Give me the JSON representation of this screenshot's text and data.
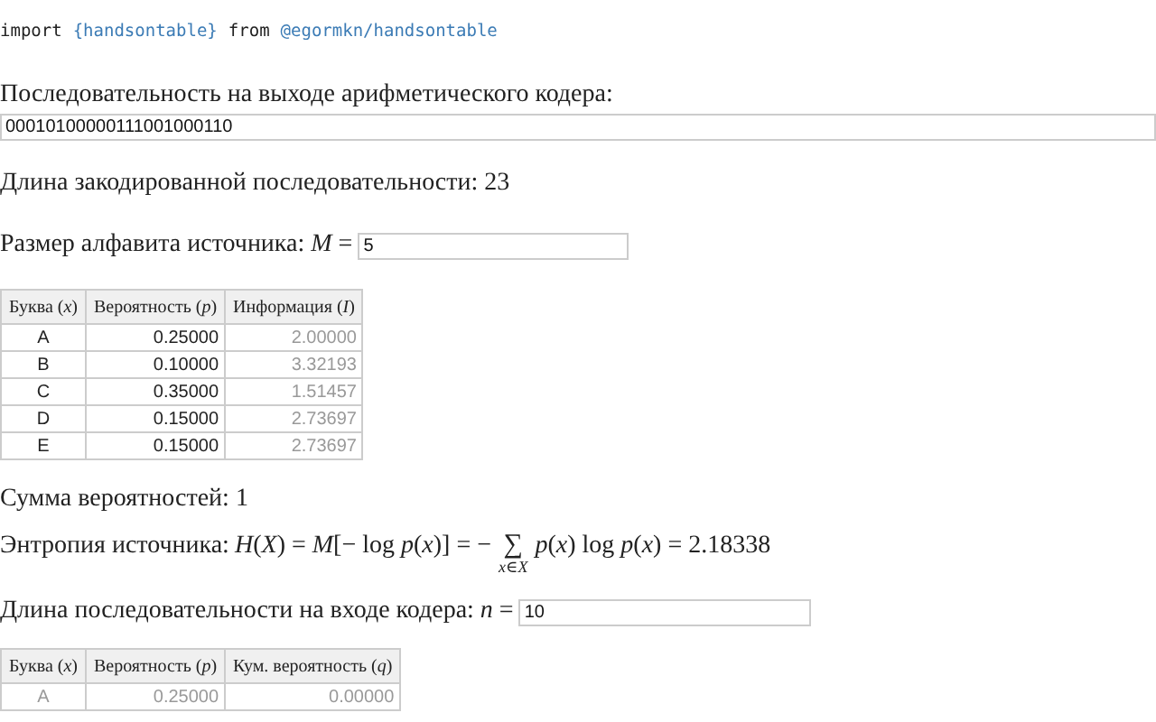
{
  "import_line": {
    "keyword": "import",
    "name": "{handsontable}",
    "from": "from",
    "package": "@egormkn/handsontable"
  },
  "output_sequence": {
    "label": "Последовательность на выходе арифметического кодера:",
    "value": "00010100000111001000110"
  },
  "encoded_length": "Длина закодированной последовательности: 23",
  "alphabet_size": {
    "label": "Размер алфавита источника: *M* =",
    "value": "5"
  },
  "table_1": {
    "columns": [
      {
        "title": "Буква (*x*)",
        "readonly": false
      },
      {
        "title": "Вероятность (*p*)",
        "readonly": false
      },
      {
        "title": "Информация (*I*)",
        "readonly": true
      }
    ],
    "rows": [
      [
        "A",
        "0.25000",
        "2.00000"
      ],
      [
        "B",
        "0.10000",
        "3.32193"
      ],
      [
        "C",
        "0.35000",
        "1.51457"
      ],
      [
        "D",
        "0.15000",
        "2.73697"
      ],
      [
        "E",
        "0.15000",
        "2.73697"
      ]
    ]
  },
  "probability_sum": "Сумма вероятностей: 1",
  "entropy": {
    "label": "Энтропия источника:",
    "formula_left": "*H*(*X*) = *M*[− log *p*(*x*)] = −",
    "sum_sign": "∑",
    "sum_under": "*x*∈*X*",
    "formula_right": "*p*(*x*) log *p*(*x*) = 2.18338"
  },
  "input_length": {
    "label": "Длина последовательности на входе кодера: *n* =",
    "value": "10"
  },
  "table_2": {
    "columns": [
      {
        "title": "Буква (*x*)",
        "readonly": true
      },
      {
        "title": "Вероятность (*p*)",
        "readonly": true
      },
      {
        "title": "Кум. вероятность (*q*)",
        "readonly": true
      }
    ],
    "rows": [
      [
        "A",
        "0.25000",
        "0.00000"
      ]
    ]
  }
}
